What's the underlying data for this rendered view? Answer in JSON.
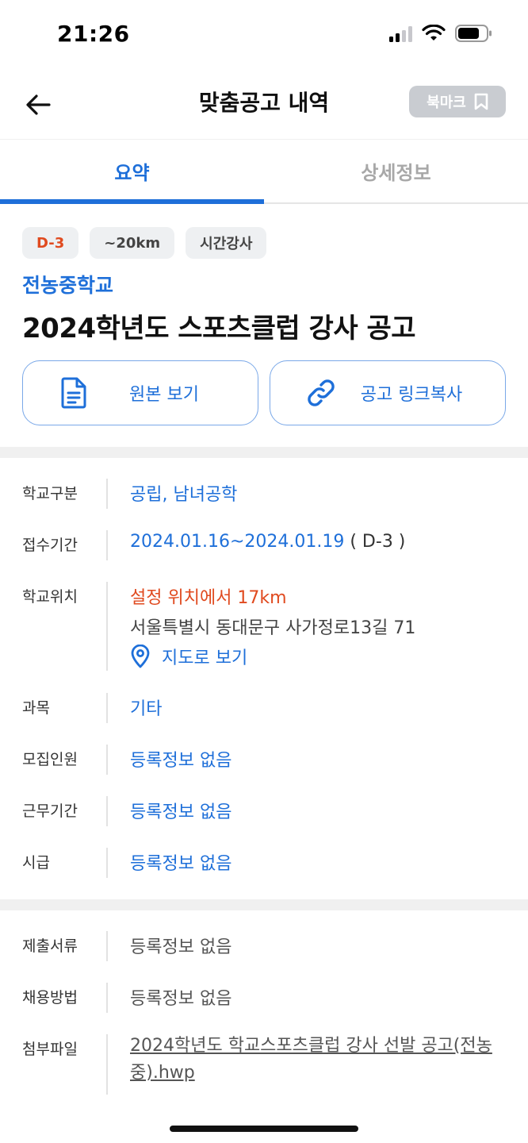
{
  "status_bar": {
    "time": "21:26"
  },
  "nav": {
    "title": "맞춤공고 내역",
    "bookmark_label": "북마크"
  },
  "tabs": [
    {
      "label": "요약"
    },
    {
      "label": "상세정보"
    }
  ],
  "chips": [
    "D-3",
    "~20km",
    "시간강사"
  ],
  "school_name": "전농중학교",
  "post_title": "2024학년도 스포츠클럽 강사 공고",
  "actions": {
    "original": "원본 보기",
    "copy_link": "공고 링크복사"
  },
  "info": {
    "school_type_label": "학교구분",
    "school_type": "공립, 남녀공학",
    "period_label": "접수기간",
    "period": "2024.01.16~2024.01.19",
    "period_dday": "( D-3 )",
    "location_label": "학교위치",
    "distance": "설정 위치에서 17km",
    "address": "서울특별시 동대문구 사가정로13길 71",
    "map_link": "지도로 보기",
    "subject_label": "과목",
    "subject": "기타",
    "recruit_label": "모집인원",
    "recruit": "등록정보 없음",
    "work_period_label": "근무기간",
    "work_period": "등록정보 없음",
    "wage_label": "시급",
    "wage": "등록정보 없음"
  },
  "extra": {
    "documents_label": "제출서류",
    "documents": "등록정보 없음",
    "method_label": "채용방법",
    "method": "등록정보 없음",
    "attachment_label": "첨부파일",
    "attachment": "2024학년도 학교스포츠클럽 강사 선발 공고(전농중).hwp"
  },
  "colors": {
    "accent": "#1e6fd9",
    "warning": "#e04a1f",
    "bookmark_bg": "#c9ccd1"
  }
}
